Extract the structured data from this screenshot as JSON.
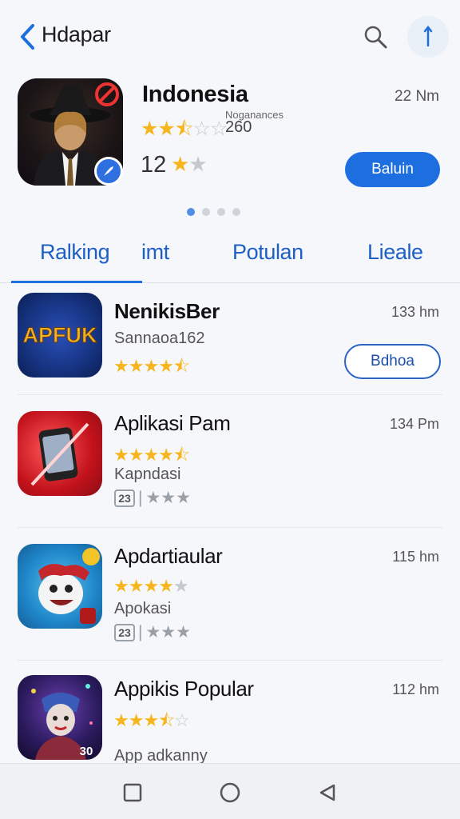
{
  "header": {
    "title": "Hdapar"
  },
  "featured": {
    "title": "Indonesia",
    "time": "22 Nm",
    "rating_stars": 2.5,
    "meta_label": "Noganances",
    "meta_count": "260",
    "rating_value": "12",
    "button_label": "Baluin",
    "carousel_pages": 4,
    "carousel_active": 0
  },
  "tabs": [
    {
      "label": "Ralking",
      "active": true
    },
    {
      "label": "imt",
      "active": false
    },
    {
      "label": "Potulan",
      "active": false
    },
    {
      "label": "Lieale",
      "active": false
    }
  ],
  "apps": [
    {
      "name": "NenikisBer",
      "time": "133 hm",
      "sub": "Sannaoa162",
      "stars": 4.5,
      "button": "Bdhoa",
      "icon_label": "APFUK"
    },
    {
      "name": "Aplikasi Pam",
      "time": "134 Pm",
      "sub": "Kapndasi",
      "stars": 4.5,
      "badge": "23"
    },
    {
      "name": "Apdartiaular",
      "time": "115 hm",
      "sub": "Apokasi",
      "stars": 4,
      "badge": "23"
    },
    {
      "name": "Appikis Popular",
      "time": "112 hm",
      "sub": "App adkanny",
      "stars": 3.5,
      "icon_label": "30"
    }
  ],
  "colors": {
    "accent": "#1d6fe0",
    "star": "#f6b51c",
    "star_off": "#c4c8cf"
  }
}
